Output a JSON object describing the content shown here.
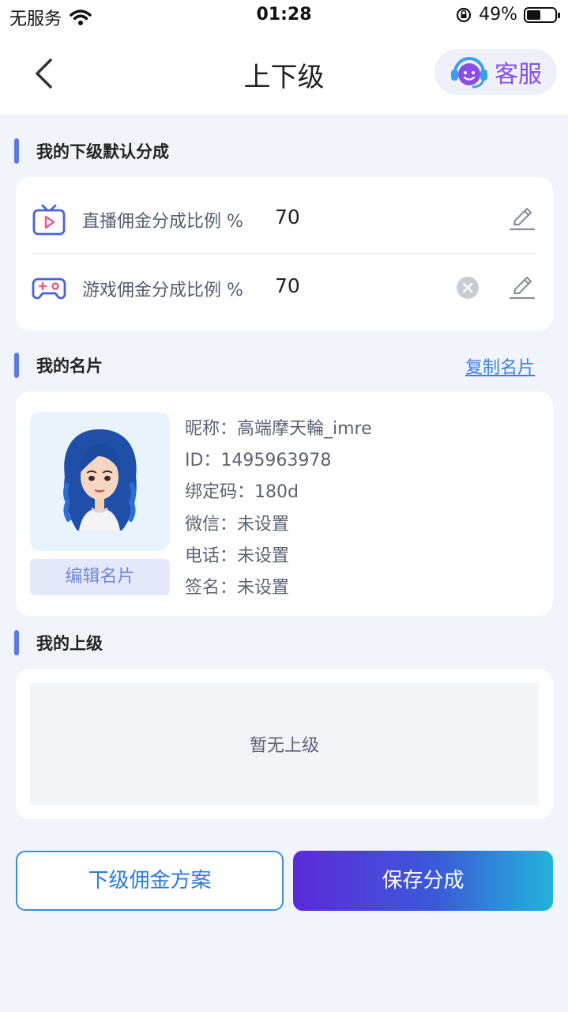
{
  "status_bar": {
    "carrier": "无服务",
    "time": "01:28",
    "battery_percent": "49%",
    "battery_level": 0.49,
    "icons": [
      "wifi-icon",
      "rotation-lock-icon",
      "battery-icon"
    ]
  },
  "nav": {
    "title": "上下级",
    "service_label": "客服"
  },
  "default_split": {
    "heading": "我的下级默认分成",
    "rows": [
      {
        "label": "直播佣金分成比例 %",
        "value": "70",
        "icon": "live-tv-icon"
      },
      {
        "label": "游戏佣金分成比例 %",
        "value": "70",
        "icon": "gamepad-icon"
      }
    ]
  },
  "card": {
    "heading": "我的名片",
    "copy_link": "复制名片",
    "edit_button": "编辑名片",
    "fields": [
      {
        "key": "昵称：",
        "value": "高端摩天輪_imre"
      },
      {
        "key": "ID：",
        "value": "1495963978"
      },
      {
        "key": "绑定码：",
        "value": "180d"
      },
      {
        "key": "微信：",
        "value": "未设置"
      },
      {
        "key": "电话：",
        "value": "未设置"
      },
      {
        "key": "签名：",
        "value": "未设置"
      }
    ]
  },
  "superior": {
    "heading": "我的上级",
    "empty_text": "暂无上级"
  },
  "buttons": {
    "commission_plan": "下级佣金方案",
    "save_split": "保存分成"
  },
  "colors": {
    "accent": "#5b78e6",
    "link": "#3d7ee8",
    "service_purple": "#8552e6",
    "page_bg": "#f2f4fb"
  }
}
